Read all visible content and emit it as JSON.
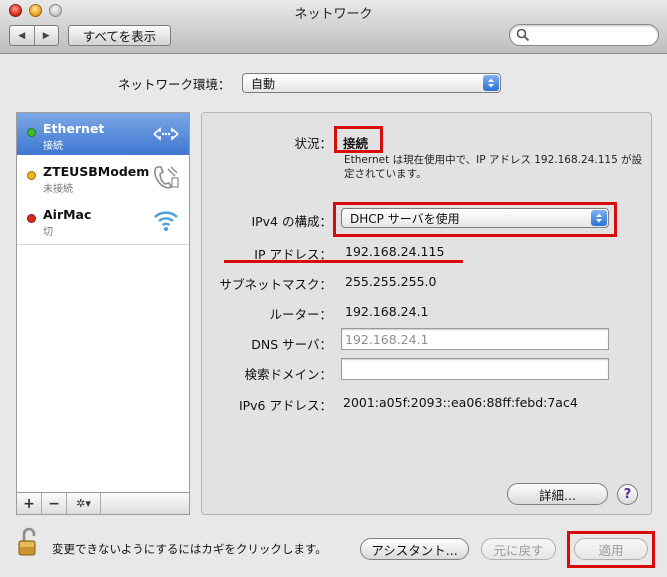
{
  "window": {
    "title": "ネットワーク"
  },
  "toolbar": {
    "back_icon": "back-arrow-icon",
    "forward_icon": "forward-arrow-icon",
    "show_all_label": "すべてを表示",
    "search_placeholder": ""
  },
  "location": {
    "label": "ネットワーク環境：",
    "value": "自動"
  },
  "services": [
    {
      "name": "Ethernet",
      "status": "接続",
      "status_color": "#3fbf2f",
      "icon": "ethernet-arrows-icon",
      "selected": true
    },
    {
      "name": "ZTEUSBModem",
      "status": "未接続",
      "status_color": "#f0b21a",
      "icon": "phone-modem-icon",
      "selected": false
    },
    {
      "name": "AirMac",
      "status": "切",
      "status_color": "#d9251c",
      "icon": "wifi-icon",
      "selected": false
    }
  ],
  "sidebar_controls": {
    "add": "+",
    "remove": "−",
    "gear": "✲▾"
  },
  "detail": {
    "status_label": "状況：",
    "status_value": "接続",
    "status_description": "Ethernet は現在使用中で、IP アドレス 192.168.24.115 が設定されています。",
    "ipv4_label": "IPv4 の構成：",
    "ipv4_value": "DHCP サーバを使用",
    "ip_label": "IP アドレス：",
    "ip_value": "192.168.24.115",
    "subnet_label": "サブネットマスク：",
    "subnet_value": "255.255.255.0",
    "router_label": "ルーター：",
    "router_value": "192.168.24.1",
    "dns_label": "DNS サーバ：",
    "dns_placeholder": "192.168.24.1",
    "search_domain_label": "検索ドメイン：",
    "search_domain_value": "",
    "ipv6_label": "IPv6 アドレス：",
    "ipv6_value": "2001:a05f:2093::ea06:88ff:febd:7ac4",
    "advanced_label": "詳細...",
    "help_label": "?"
  },
  "bottom": {
    "lock_text": "変更できないようにするにはカギをクリックします。",
    "assistant_label": "アシスタント...",
    "revert_label": "元に戻す",
    "apply_label": "適用"
  },
  "colors": {
    "highlight": "#d60c0c",
    "selection": "#3f77d0"
  }
}
